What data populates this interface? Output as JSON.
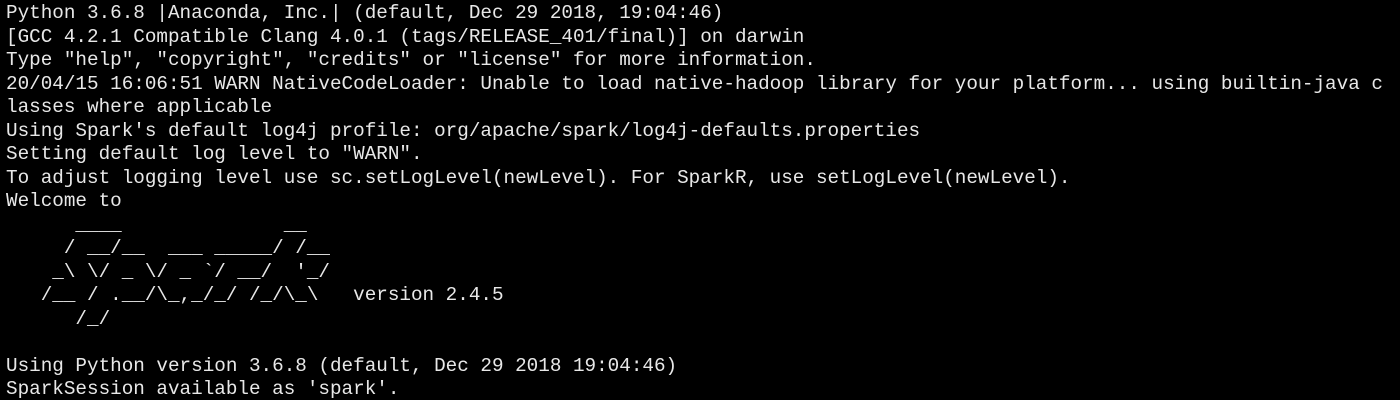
{
  "terminal": {
    "background": "#000000",
    "foreground": "#e8e8e8",
    "lines": [
      "Python 3.6.8 |Anaconda, Inc.| (default, Dec 29 2018, 19:04:46)",
      "[GCC 4.2.1 Compatible Clang 4.0.1 (tags/RELEASE_401/final)] on darwin",
      "Type \"help\", \"copyright\", \"credits\" or \"license\" for more information.",
      "20/04/15 16:06:51 WARN NativeCodeLoader: Unable to load native-hadoop library for your platform... using builtin-java c",
      "lasses where applicable",
      "Using Spark's default log4j profile: org/apache/spark/log4j-defaults.properties",
      "Setting default log level to \"WARN\".",
      "To adjust logging level use sc.setLogLevel(newLevel). For SparkR, use setLogLevel(newLevel).",
      "Welcome to",
      "      ____              __",
      "     / __/__  ___ _____/ /__",
      "    _\\ \\/ _ \\/ _ `/ __/  '_/",
      "   /__ / .__/\\_,_/_/ /_/\\_\\   version 2.4.5",
      "      /_/",
      "",
      "Using Python version 3.6.8 (default, Dec 29 2018 19:04:46)",
      "SparkSession available as 'spark'."
    ]
  }
}
